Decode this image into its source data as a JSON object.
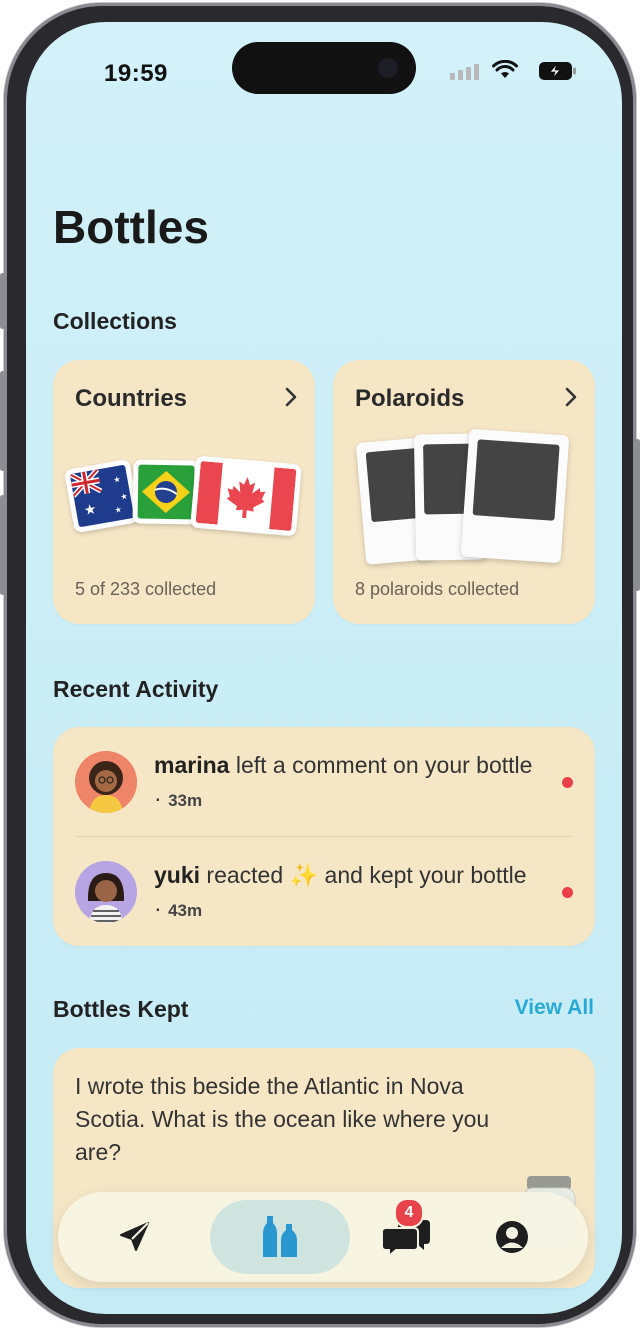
{
  "status_bar": {
    "time": "19:59"
  },
  "page": {
    "title": "Bottles"
  },
  "collections": {
    "heading": "Collections",
    "countries": {
      "title": "Countries",
      "subtitle": "5 of 233 collected",
      "flags": [
        "australia-flag",
        "brazil-flag",
        "canada-flag"
      ]
    },
    "polaroids": {
      "title": "Polaroids",
      "subtitle": "8 polaroids collected"
    }
  },
  "recent_activity": {
    "heading": "Recent Activity",
    "items": [
      {
        "user": "marina",
        "text_before": " left a comment on your bottle",
        "emoji": "",
        "text_after": "",
        "time": "33m",
        "unread": true
      },
      {
        "user": "yuki",
        "text_before": " reacted ",
        "emoji": "✨",
        "text_after": " and kept your bottle",
        "time": "43m",
        "unread": true
      }
    ]
  },
  "bottles_kept": {
    "heading": "Bottles Kept",
    "view_all": "View All",
    "message": "I wrote this beside the Atlantic in Nova Scotia. What is the ocean like where you are?"
  },
  "tab_bar": {
    "tabs": [
      {
        "name": "send-icon",
        "active": false
      },
      {
        "name": "bottles-icon",
        "active": true
      },
      {
        "name": "messages-icon",
        "active": false,
        "badge": "4"
      },
      {
        "name": "profile-icon",
        "active": false
      }
    ]
  },
  "colors": {
    "background": "#d2f1f9",
    "card": "#f5e6c6",
    "accent": "#29a9d6",
    "badge": "#e8424b",
    "bottle_blue": "#2a98d0"
  }
}
